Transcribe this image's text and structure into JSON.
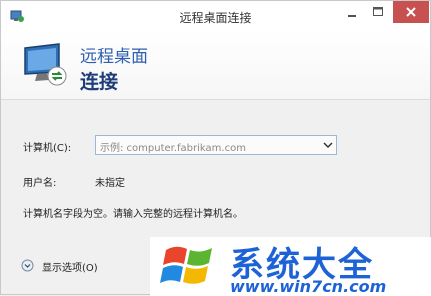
{
  "window": {
    "title": "远程桌面连接",
    "title_color": "#333333",
    "close_color": "#c75050"
  },
  "header": {
    "line1": "远程桌面",
    "line2": "连接",
    "line1_color": "#2d5fb0",
    "line2_color": "#1d3c78"
  },
  "form": {
    "computer_label": "计算机(C):",
    "computer_placeholder": "示例: computer.fabrikam.com",
    "username_label": "用户名:",
    "username_value": "未指定",
    "info_message": "计算机名字段为空。请输入完整的远程计算机名。"
  },
  "footer": {
    "show_options_label": "显示选项(O)",
    "show_options_icon": "chevron-down-circle-icon"
  },
  "watermark": {
    "title": "系统大全",
    "url": "www.win7cn.com",
    "color": "#1e63d6"
  }
}
